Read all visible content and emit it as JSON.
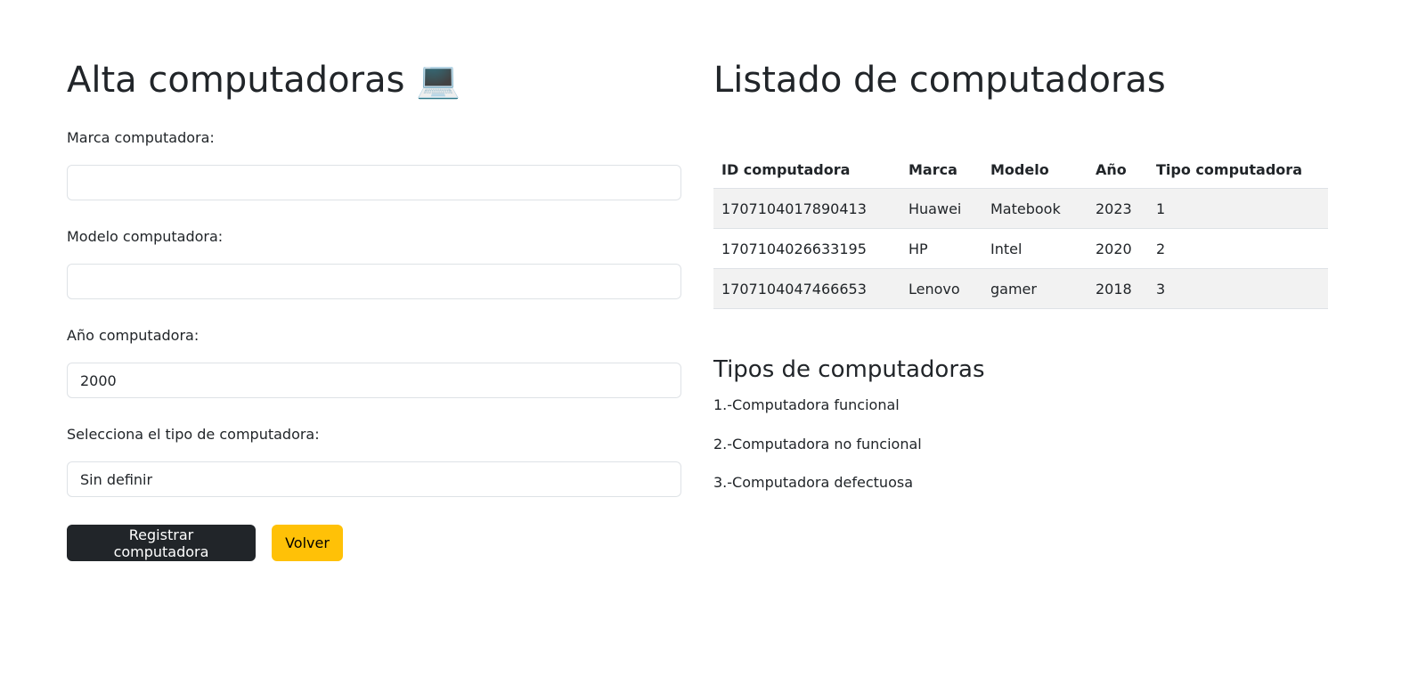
{
  "form": {
    "title": "Alta computadoras 💻",
    "marca_label": "Marca computadora:",
    "marca_value": "",
    "modelo_label": "Modelo computadora:",
    "modelo_value": "",
    "anio_label": "Año computadora:",
    "anio_value": "2000",
    "tipo_label": "Selecciona el tipo de computadora:",
    "tipo_selected": "Sin definir",
    "submit_label": "Registrar computadora",
    "back_label": "Volver"
  },
  "listado": {
    "title": "Listado de computadoras",
    "headers": [
      "ID computadora",
      "Marca",
      "Modelo",
      "Año",
      "Tipo computadora"
    ],
    "rows": [
      [
        "1707104017890413",
        "Huawei",
        "Matebook",
        "2023",
        "1"
      ],
      [
        "1707104026633195",
        "HP",
        "Intel",
        "2020",
        "2"
      ],
      [
        "1707104047466653",
        "Lenovo",
        "gamer",
        "2018",
        "3"
      ]
    ]
  },
  "tipos": {
    "title": "Tipos de computadoras",
    "items": [
      "1.-Computadora funcional",
      "2.-Computadora no funcional",
      "3.-Computadora defectuosa"
    ]
  }
}
